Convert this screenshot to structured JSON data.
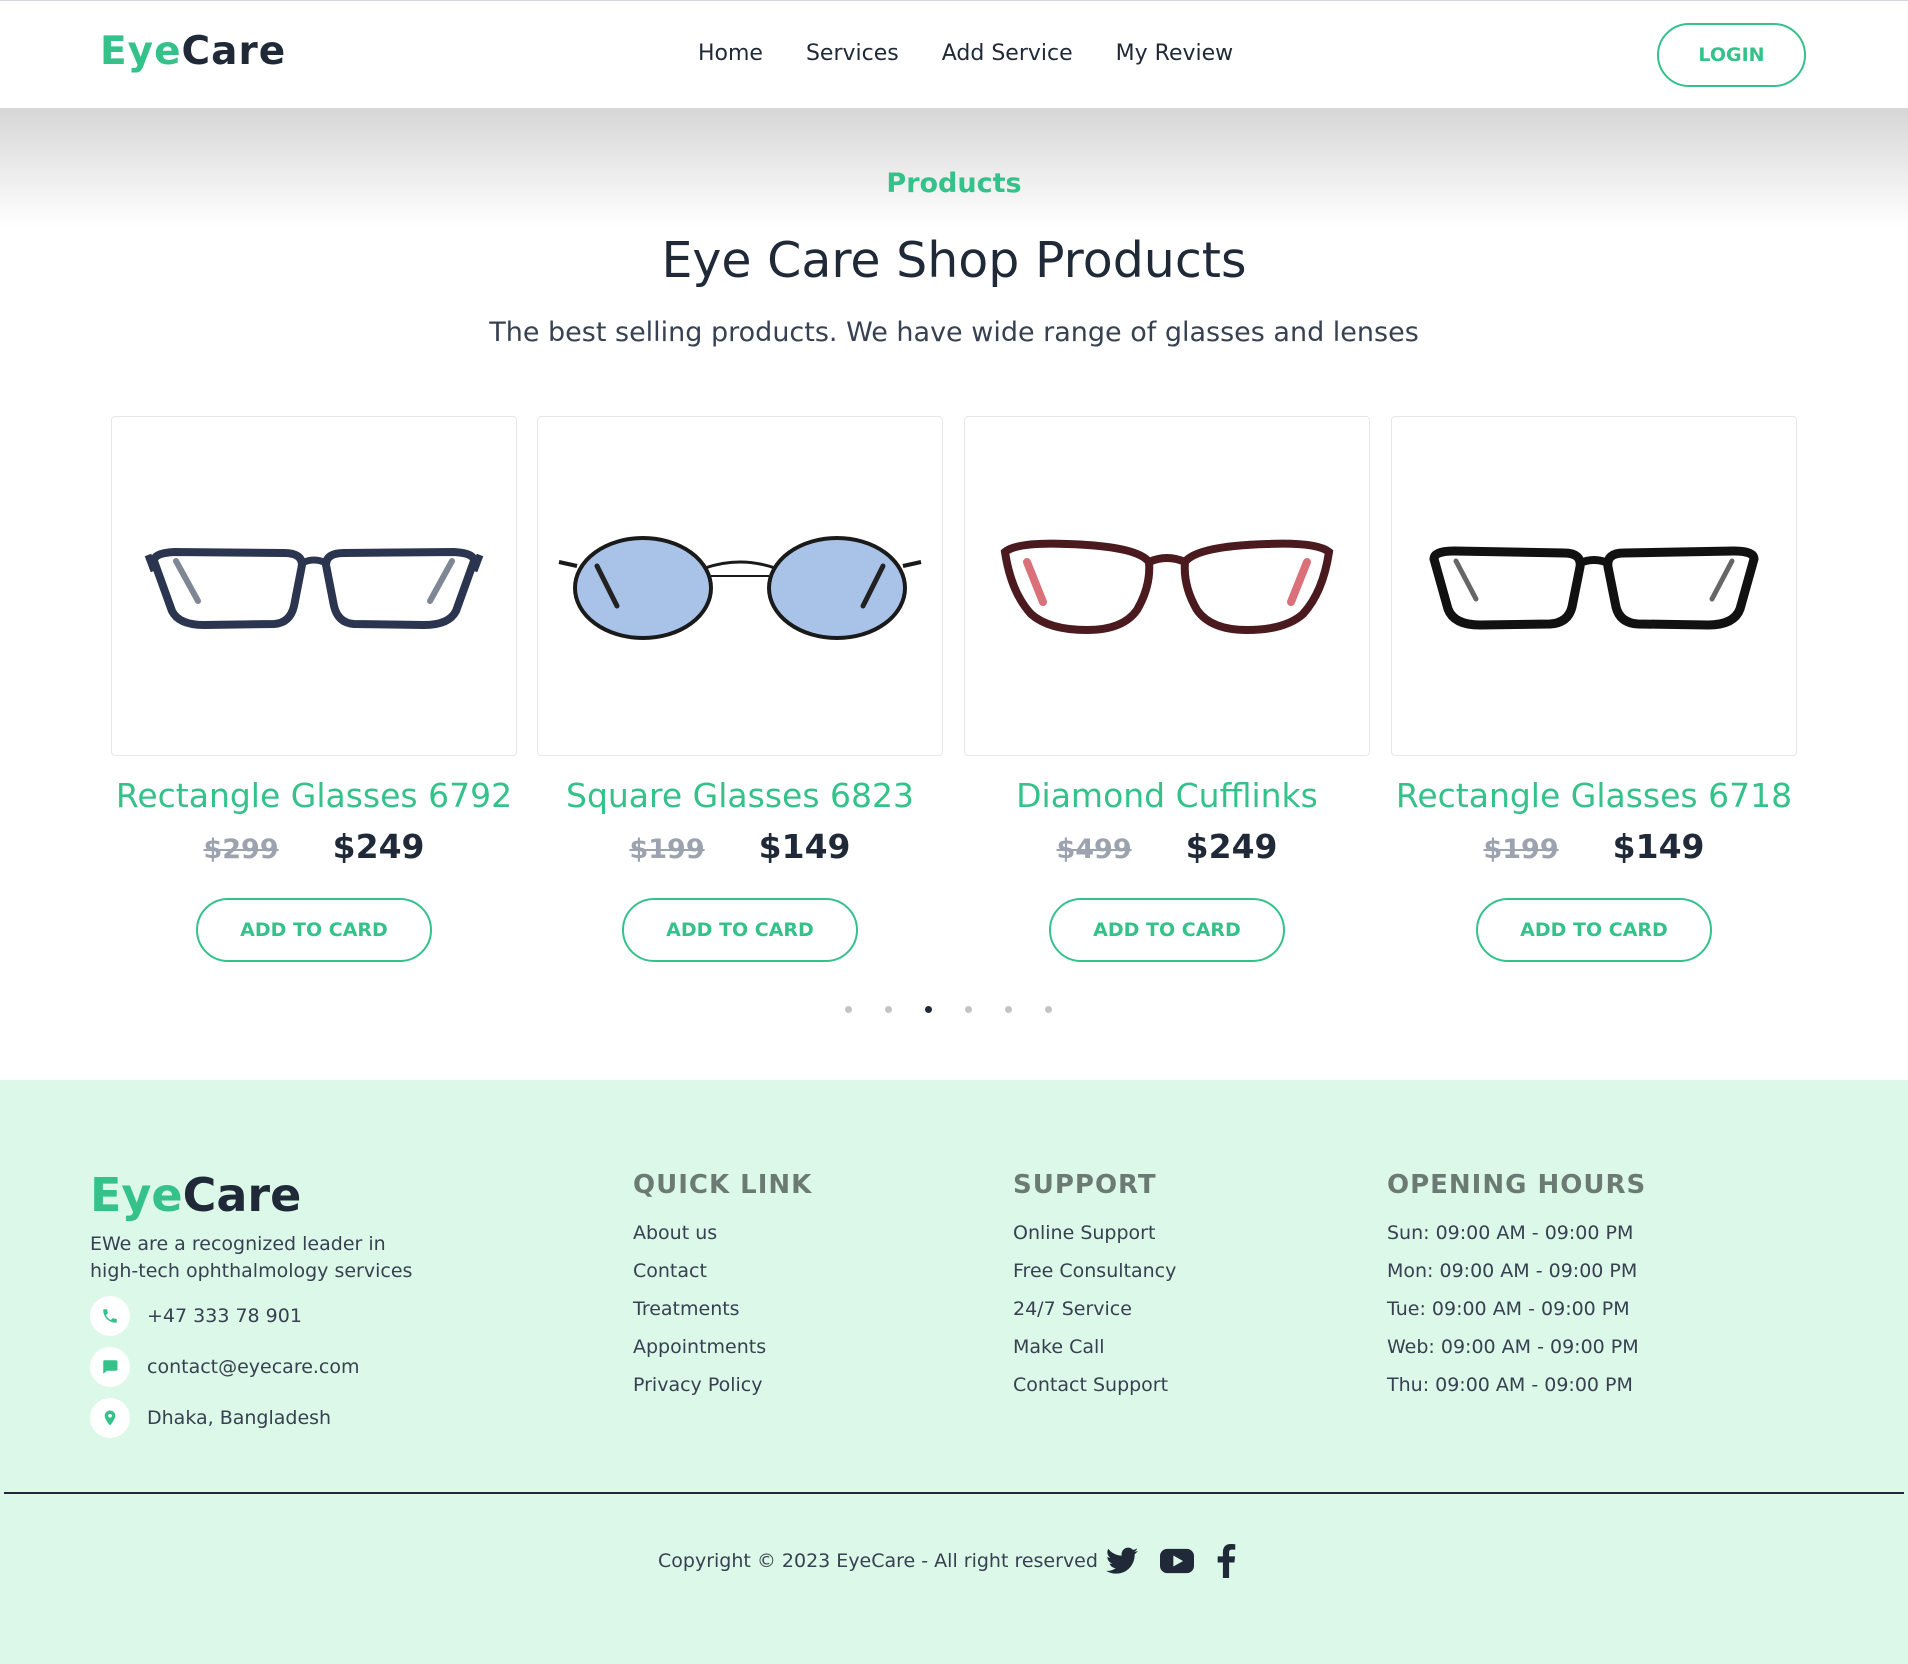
{
  "header": {
    "logo_eye": "Eye",
    "logo_care": "Care",
    "nav": [
      "Home",
      "Services",
      "Add Service",
      "My Review"
    ],
    "login_label": "LOGIN"
  },
  "products_section": {
    "kicker": "Products",
    "title": "Eye Care Shop Products",
    "subtitle": "The best selling products. We have wide range of glasses and lenses",
    "cards": [
      {
        "name": "Rectangle Glasses 6792",
        "old_price": "$299",
        "new_price": "$249",
        "button": "ADD TO CARD",
        "image": "rectangle-navy-glasses"
      },
      {
        "name": "Square Glasses 6823",
        "old_price": "$199",
        "new_price": "$149",
        "button": "ADD TO CARD",
        "image": "round-blue-tinted-glasses"
      },
      {
        "name": "Diamond Cufflinks",
        "old_price": "$499",
        "new_price": "$249",
        "button": "ADD TO CARD",
        "image": "burgundy-cat-eye-glasses"
      },
      {
        "name": "Rectangle Glasses 6718",
        "old_price": "$199",
        "new_price": "$149",
        "button": "ADD TO CARD",
        "image": "rectangle-black-glasses"
      }
    ],
    "carousel_dots": 6,
    "carousel_active_index": 2
  },
  "footer": {
    "logo_eye": "Eye",
    "logo_care": "Care",
    "description": "EWe are a recognized leader in high-tech ophthalmology services",
    "contacts": [
      {
        "icon": "phone-icon",
        "text": "+47 333 78 901"
      },
      {
        "icon": "message-icon",
        "text": "contact@eyecare.com"
      },
      {
        "icon": "location-pin-icon",
        "text": "Dhaka, Bangladesh"
      }
    ],
    "quick_link": {
      "title": "QUICK LINK",
      "items": [
        "About us",
        "Contact",
        "Treatments",
        "Appointments",
        "Privacy Policy"
      ]
    },
    "support": {
      "title": "SUPPORT",
      "items": [
        "Online Support",
        "Free Consultancy",
        "24/7 Service",
        "Make Call",
        "Contact Support"
      ]
    },
    "opening_hours": {
      "title": "OPENING HOURS",
      "items": [
        "Sun: 09:00 AM - 09:00 PM",
        "Mon: 09:00 AM - 09:00 PM",
        "Tue: 09:00 AM - 09:00 PM",
        "Web: 09:00 AM - 09:00 PM",
        "Thu: 09:00 AM - 09:00 PM"
      ]
    },
    "copyright": "Copyright © 2023 EyeCare - All right reserved",
    "social": [
      "twitter-icon",
      "youtube-icon",
      "facebook-icon"
    ]
  },
  "colors": {
    "accent": "#34c28a",
    "dark": "#1f2937",
    "footer_bg": "#dcf8e8"
  }
}
